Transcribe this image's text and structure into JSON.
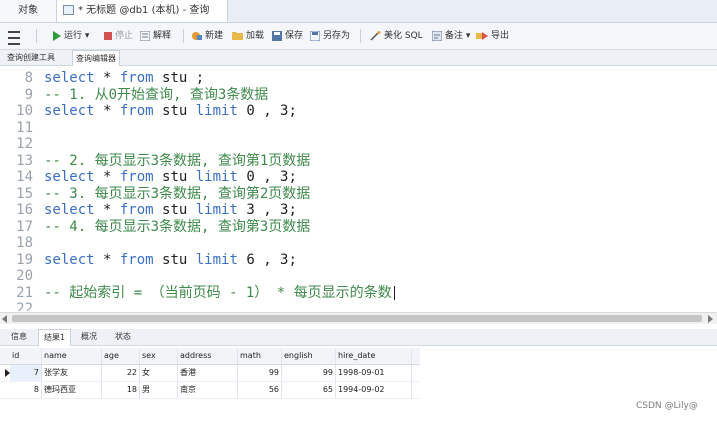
{
  "tabs": {
    "objects": "对象",
    "query": "* 无标题 @db1 (本机) - 查询"
  },
  "toolbar": {
    "run": "运行",
    "run_dropdown": "▾",
    "stop": "停止",
    "explain": "解释",
    "new": "新建",
    "load": "加载",
    "save": "保存",
    "save_as": "另存为",
    "beautify": "美化 SQL",
    "note": "备注",
    "note_dropdown": "▾",
    "export": "导出"
  },
  "subtabs": {
    "query_builder": "查询创建工具",
    "query_editor": "查询编辑器"
  },
  "editor": {
    "lines": [
      {
        "n": "8",
        "parts": [
          [
            "kw",
            "select"
          ],
          [
            "tx",
            " * "
          ],
          [
            "kw",
            "from"
          ],
          [
            "tx",
            " stu ;"
          ]
        ]
      },
      {
        "n": "9",
        "parts": [
          [
            "cm",
            "-- 1. 从0开始查询, 查询3条数据"
          ]
        ]
      },
      {
        "n": "10",
        "parts": [
          [
            "kw",
            "select"
          ],
          [
            "tx",
            " * "
          ],
          [
            "kw",
            "from"
          ],
          [
            "tx",
            " stu "
          ],
          [
            "kw",
            "limit"
          ],
          [
            "tx",
            " 0 , 3;"
          ]
        ]
      },
      {
        "n": "11",
        "parts": []
      },
      {
        "n": "12",
        "parts": []
      },
      {
        "n": "13",
        "parts": [
          [
            "cm",
            "-- 2. 每页显示3条数据, 查询第1页数据"
          ]
        ]
      },
      {
        "n": "14",
        "parts": [
          [
            "kw",
            "select"
          ],
          [
            "tx",
            " * "
          ],
          [
            "kw",
            "from"
          ],
          [
            "tx",
            " stu "
          ],
          [
            "kw",
            "limit"
          ],
          [
            "tx",
            " 0 , 3;"
          ]
        ]
      },
      {
        "n": "15",
        "parts": [
          [
            "cm",
            "-- 3. 每页显示3条数据, 查询第2页数据"
          ]
        ]
      },
      {
        "n": "16",
        "parts": [
          [
            "kw",
            "select"
          ],
          [
            "tx",
            " * "
          ],
          [
            "kw",
            "from"
          ],
          [
            "tx",
            " stu "
          ],
          [
            "kw",
            "limit"
          ],
          [
            "tx",
            " 3 , 3;"
          ]
        ]
      },
      {
        "n": "17",
        "parts": [
          [
            "cm",
            "-- 4. 每页显示3条数据, 查询第3页数据"
          ]
        ]
      },
      {
        "n": "18",
        "parts": []
      },
      {
        "n": "19",
        "parts": [
          [
            "kw",
            "select"
          ],
          [
            "tx",
            " * "
          ],
          [
            "kw",
            "from"
          ],
          [
            "tx",
            " stu "
          ],
          [
            "kw",
            "limit"
          ],
          [
            "tx",
            " 6 , 3;"
          ]
        ]
      },
      {
        "n": "20",
        "parts": []
      },
      {
        "n": "21",
        "parts": [
          [
            "cm",
            "-- 起始索引 = （当前页码 - 1） * 每页显示的条数"
          ]
        ],
        "caret": true
      },
      {
        "n": "22",
        "parts": []
      }
    ]
  },
  "result_tabs": {
    "info": "信息",
    "result1": "结果1",
    "profile": "概况",
    "status": "状态"
  },
  "grid": {
    "columns": [
      "id",
      "name",
      "age",
      "sex",
      "address",
      "math",
      "english",
      "hire_date"
    ],
    "rows": [
      [
        "7",
        "张学友",
        "22",
        "女",
        "香港",
        "99",
        "99",
        "1998-09-01"
      ],
      [
        "8",
        "德玛西亚",
        "18",
        "男",
        "南京",
        "56",
        "65",
        "1994-09-02"
      ]
    ]
  },
  "watermark": "CSDN @Lily@",
  "colors": {
    "keyword": "#3b6fc4",
    "comment": "#3e8a4b",
    "line_number": "#9aa2ad"
  }
}
